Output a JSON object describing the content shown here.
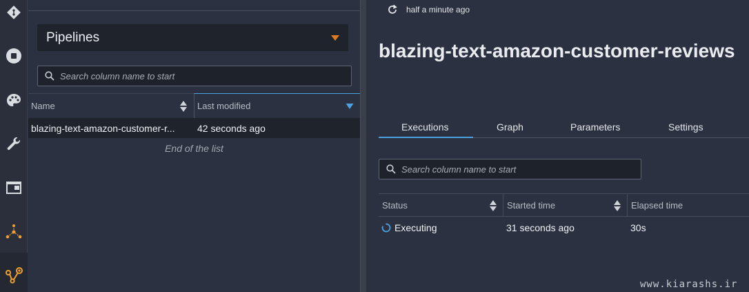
{
  "left_panel": {
    "dropdown": {
      "label": "Pipelines"
    },
    "search": {
      "placeholder": "Search column name to start"
    },
    "table": {
      "columns": [
        "Name",
        "Last modified"
      ],
      "rows": [
        {
          "name": "blazing-text-amazon-customer-r...",
          "last_modified": "42 seconds ago"
        }
      ],
      "end_text": "End of the list"
    }
  },
  "right_panel": {
    "refresh_text": "half a minute ago",
    "title": "blazing-text-amazon-customer-reviews",
    "tabs": [
      "Executions",
      "Graph",
      "Parameters",
      "Settings"
    ],
    "active_tab": "Executions",
    "search": {
      "placeholder": "Search column name to start"
    },
    "table": {
      "columns": [
        "Status",
        "Started time",
        "Elapsed time"
      ],
      "rows": [
        {
          "status": "Executing",
          "started": "31 seconds ago",
          "elapsed": "30s"
        }
      ]
    }
  },
  "rail_icons": [
    "git-icon",
    "stop-icon",
    "palette-icon",
    "wrench-icon",
    "window-icon",
    "pipeline-icon",
    "model-icon"
  ],
  "colors": {
    "accent_blue": "#4aa3e0",
    "accent_orange": "#e07a1f",
    "icon_orange": "#f0a030"
  },
  "watermark": "www.kiarashs.ir"
}
